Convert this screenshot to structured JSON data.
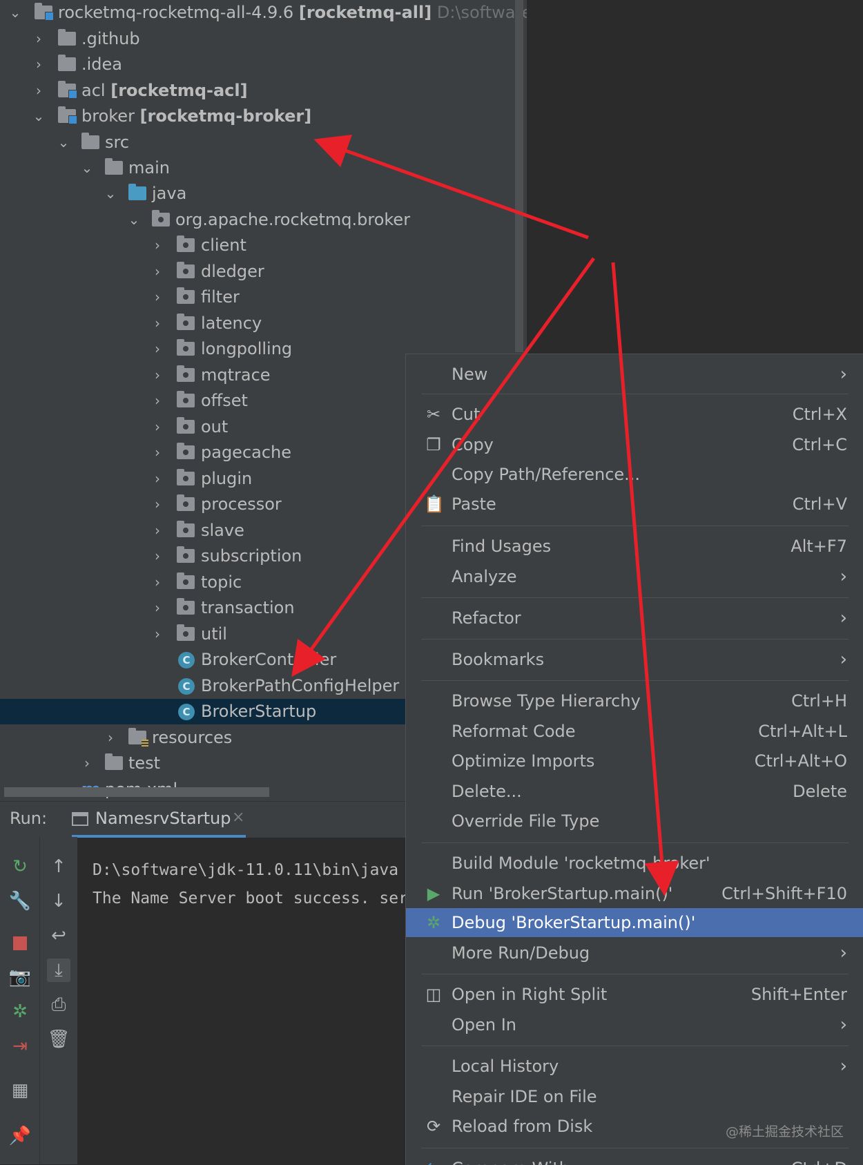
{
  "project_tree": {
    "root": {
      "name": "rocketmq-rocketmq-all-4.9.6",
      "module": "[rocketmq-all]",
      "path": "D:\\software\\rc"
    },
    "items": [
      {
        "label": ".github"
      },
      {
        "label": ".idea"
      },
      {
        "label": "acl",
        "module": "[rocketmq-acl]"
      },
      {
        "label": "broker",
        "module": "[rocketmq-broker]"
      },
      {
        "label": "src"
      },
      {
        "label": "main"
      },
      {
        "label": "java"
      },
      {
        "label": "org.apache.rocketmq.broker"
      },
      {
        "label": "client"
      },
      {
        "label": "dledger"
      },
      {
        "label": "filter"
      },
      {
        "label": "latency"
      },
      {
        "label": "longpolling"
      },
      {
        "label": "mqtrace"
      },
      {
        "label": "offset"
      },
      {
        "label": "out"
      },
      {
        "label": "pagecache"
      },
      {
        "label": "plugin"
      },
      {
        "label": "processor"
      },
      {
        "label": "slave"
      },
      {
        "label": "subscription"
      },
      {
        "label": "topic"
      },
      {
        "label": "transaction"
      },
      {
        "label": "util"
      },
      {
        "label": "BrokerController",
        "icon_letter": "C"
      },
      {
        "label": "BrokerPathConfigHelper",
        "icon_letter": "C"
      },
      {
        "label": "BrokerStartup",
        "icon_letter": "C"
      },
      {
        "label": "resources"
      },
      {
        "label": "test"
      },
      {
        "label": "pom.xml",
        "icon_letter": "m"
      }
    ]
  },
  "run_panel": {
    "label": "Run:",
    "tab": "NamesrvStartup",
    "tab_close": "×",
    "console_lines": [
      "D:\\software\\jdk-11.0.11\\bin\\java",
      "The Name Server boot success. ser"
    ]
  },
  "context_menu": {
    "items": [
      {
        "label": "New"
      },
      {
        "label": "Cut",
        "shortcut": "Ctrl+X"
      },
      {
        "label": "Copy",
        "shortcut": "Ctrl+C"
      },
      {
        "label": "Copy Path/Reference..."
      },
      {
        "label": "Paste",
        "shortcut": "Ctrl+V"
      },
      {
        "label": "Find Usages",
        "shortcut": "Alt+F7"
      },
      {
        "label": "Analyze"
      },
      {
        "label": "Refactor"
      },
      {
        "label": "Bookmarks"
      },
      {
        "label": "Browse Type Hierarchy",
        "shortcut": "Ctrl+H"
      },
      {
        "label": "Reformat Code",
        "shortcut": "Ctrl+Alt+L"
      },
      {
        "label": "Optimize Imports",
        "shortcut": "Ctrl+Alt+O"
      },
      {
        "label": "Delete...",
        "shortcut": "Delete"
      },
      {
        "label": "Override File Type"
      },
      {
        "label": "Build Module 'rocketmq-broker'"
      },
      {
        "label": "Run 'BrokerStartup.main()'",
        "shortcut": "Ctrl+Shift+F10"
      },
      {
        "label": "Debug 'BrokerStartup.main()'"
      },
      {
        "label": "More Run/Debug"
      },
      {
        "label": "Open in Right Split",
        "shortcut": "Shift+Enter"
      },
      {
        "label": "Open In"
      },
      {
        "label": "Local History"
      },
      {
        "label": "Repair IDE on File"
      },
      {
        "label": "Reload from Disk"
      },
      {
        "label": "Compare With...",
        "shortcut": "Ctrl+D"
      }
    ],
    "chevron": "›"
  },
  "watermark": "@稀土掘金技术社区",
  "colors": {
    "annotation_arrow": "#e8202a",
    "highlight": "#4b6eaf",
    "selection": "#0d293e"
  }
}
